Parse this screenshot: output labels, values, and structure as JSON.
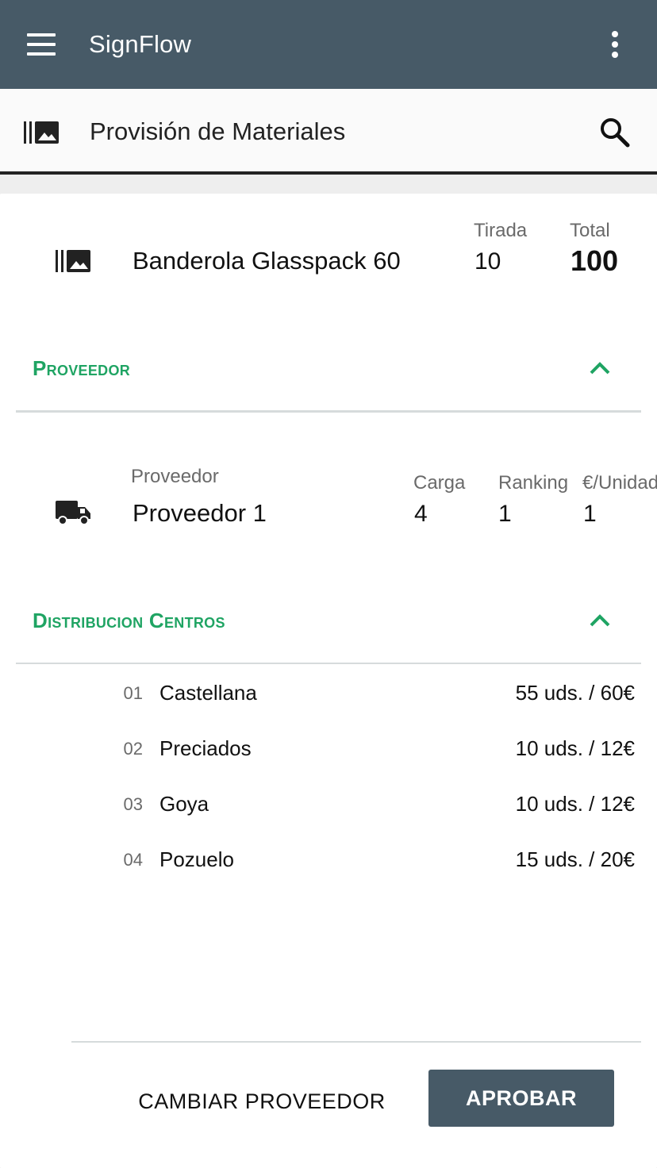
{
  "app": {
    "title": "SignFlow",
    "menu_icon": "menu-icon",
    "more_icon": "more-vert-icon"
  },
  "subheader": {
    "title": "Provisión de Materiales",
    "icon": "material-library-icon",
    "search_icon": "search-icon"
  },
  "product": {
    "name": "Banderola Glasspack 60",
    "tirada_label": "Tirada",
    "tirada_value": "10",
    "total_label": "Total",
    "total_value": "100"
  },
  "sections": {
    "proveedor_title": "Proveedor",
    "distribucion_title": "Distribucion Centros"
  },
  "supplier": {
    "label": "Proveedor",
    "name": "Proveedor 1",
    "columns": [
      {
        "label": "Carga",
        "value": "4"
      },
      {
        "label": "Ranking",
        "value": "1"
      },
      {
        "label": "€/Unidad",
        "value": "1"
      }
    ]
  },
  "centers": [
    {
      "num": "01",
      "name": "Castellana",
      "value": "55 uds. / 60€"
    },
    {
      "num": "02",
      "name": "Preciados",
      "value": "10 uds. / 12€"
    },
    {
      "num": "03",
      "name": "Goya",
      "value": "10 uds. / 12€"
    },
    {
      "num": "04",
      "name": "Pozuelo",
      "value": "15 uds. / 20€"
    }
  ],
  "actions": {
    "change_label": "CAMBIAR PROVEEDOR",
    "approve_label": "APROBAR"
  },
  "colors": {
    "appbar": "#475a67",
    "accent": "#1fa463",
    "primary_button": "#475a67"
  }
}
